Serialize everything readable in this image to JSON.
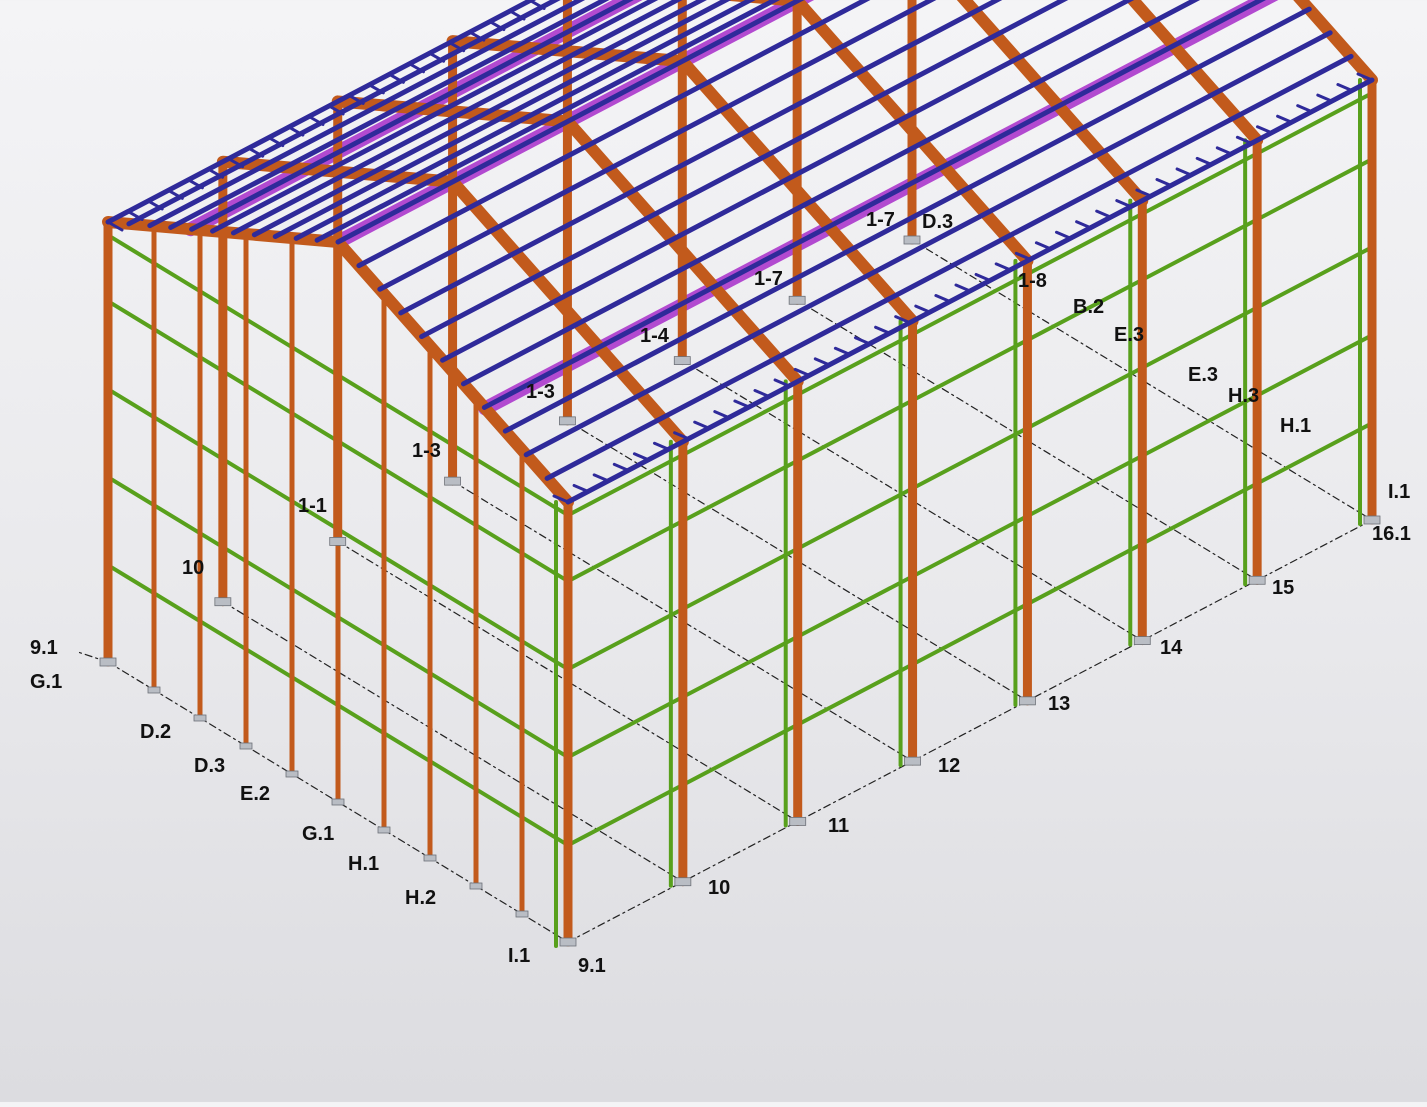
{
  "colors": {
    "frame": "#c25a1c",
    "frame_dark": "#8a3c10",
    "purlin": "#2f2a9a",
    "girt": "#58a01c",
    "bracing": "#b24ad0",
    "background": "#eeeef0"
  },
  "grid_labels": {
    "left_end": [
      "9.1",
      "G.1"
    ],
    "front_axes": [
      "D.2",
      "D.3",
      "E.2",
      "G.1",
      "H.1",
      "H.2",
      "I.1"
    ],
    "corner": "9.1",
    "side_axes": [
      "10",
      "11",
      "12",
      "13",
      "14",
      "15"
    ],
    "far_end": [
      "I.1",
      "16.1"
    ],
    "interior_10": "10"
  },
  "member_marks": [
    "1-1",
    "1-3",
    "1-3",
    "1-4",
    "1-7",
    "1-7",
    "D.3",
    "1-8",
    "B.2",
    "E.3",
    "E.3",
    "H.3",
    "H.1"
  ]
}
